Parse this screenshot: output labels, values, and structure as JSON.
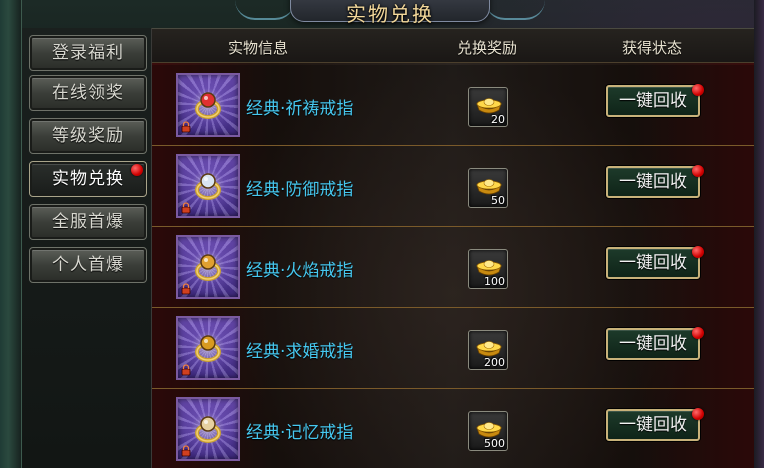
{
  "title": "实物兑换",
  "sidebar": {
    "items": [
      {
        "label": "登录福利",
        "active": false,
        "badge": false
      },
      {
        "label": "在线领奖",
        "active": false,
        "badge": false
      },
      {
        "label": "等级奖励",
        "active": false,
        "badge": false
      },
      {
        "label": "实物兑换",
        "active": true,
        "badge": true
      },
      {
        "label": "全服首爆",
        "active": false,
        "badge": false
      },
      {
        "label": "个人首爆",
        "active": false,
        "badge": false
      }
    ]
  },
  "table": {
    "headers": {
      "item_info": "实物信息",
      "reward": "兑换奖励",
      "status": "获得状态"
    },
    "rows": [
      {
        "name": "经典·祈祷戒指",
        "reward_count": "20",
        "button_label": "一键回收",
        "badge": true,
        "gem_color": "#e03030"
      },
      {
        "name": "经典·防御戒指",
        "reward_count": "50",
        "button_label": "一键回收",
        "badge": true,
        "gem_color": "#d8e4f0"
      },
      {
        "name": "经典·火焰戒指",
        "reward_count": "100",
        "button_label": "一键回收",
        "badge": true,
        "gem_color": "#e0a030"
      },
      {
        "name": "经典·求婚戒指",
        "reward_count": "200",
        "button_label": "一键回收",
        "badge": true,
        "gem_color": "#d89a20"
      },
      {
        "name": "经典·记忆戒指",
        "reward_count": "500",
        "button_label": "一键回收",
        "badge": true,
        "gem_color": "#e6d0a0"
      }
    ]
  },
  "colors": {
    "item_name": "#46c8f0",
    "title": "#f3d89a",
    "badge": "#d00000",
    "button_border": "#c8b27a"
  },
  "icons": {
    "item": "ring-icon",
    "reward": "gold-ingot-icon",
    "lock": "lock-icon",
    "badge": "red-dot-badge"
  }
}
